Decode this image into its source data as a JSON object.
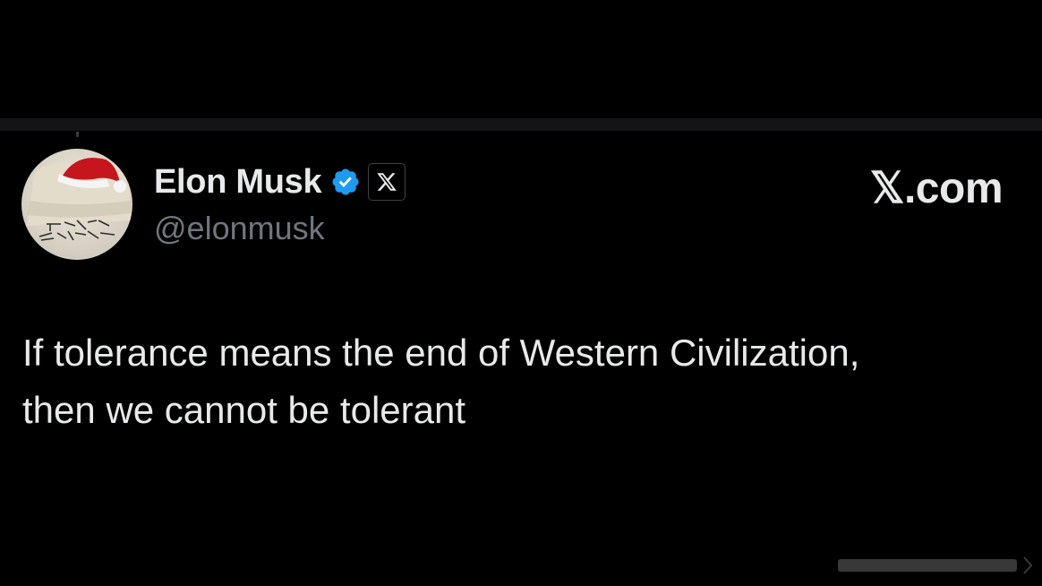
{
  "tweet": {
    "author": {
      "display_name": "Elon Musk",
      "handle": "@elonmusk",
      "verified_icon": "verified-badge-icon",
      "affiliate_icon": "x-logo-icon",
      "avatar_icon": "avatar-santa-hat"
    },
    "brand": "𝕏.com",
    "text": "If tolerance means the end of Western Civilization,\nthen we cannot be tolerant"
  },
  "colors": {
    "background": "#000000",
    "text_primary": "#e7e9ea",
    "text_secondary": "#71767b",
    "verified_blue": "#1d9bf0"
  }
}
